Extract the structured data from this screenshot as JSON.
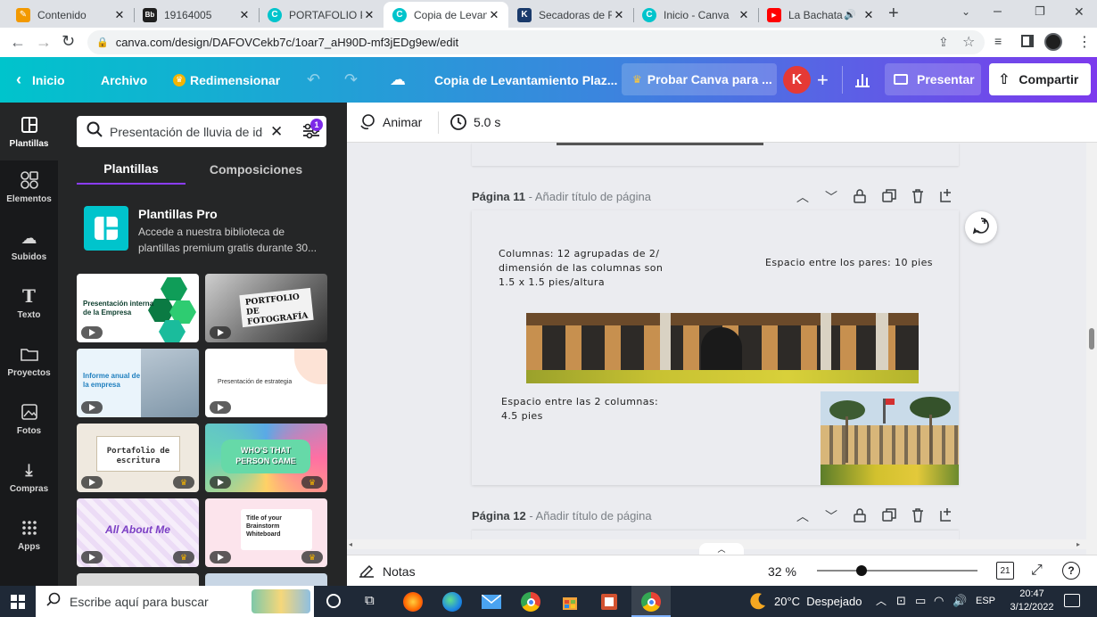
{
  "browser": {
    "tabs": [
      {
        "label": "Contenido",
        "icon": "orange-doc-icon",
        "color": "#f29900"
      },
      {
        "label": "19164005",
        "icon": "bb-icon",
        "color": "#1f1f1f"
      },
      {
        "label": "PORTAFOLIO PRO",
        "icon": "canva-icon",
        "color": "#00c4cc"
      },
      {
        "label": "Copia de Levantamiento",
        "icon": "canva-icon",
        "color": "#00c4cc"
      },
      {
        "label": "Secadoras de Ro",
        "icon": "generic-icon",
        "color": "#1a3a6b"
      },
      {
        "label": "Inicio - Canva",
        "icon": "canva-icon",
        "color": "#00c4cc"
      },
      {
        "label": "La Bachata",
        "icon": "youtube-icon",
        "color": "#ff0000"
      }
    ],
    "url": "canva.com/design/DAFOVCekb7c/1oar7_aH90D-mf3jEDg9ew/edit"
  },
  "header": {
    "home": "Inicio",
    "file": "Archivo",
    "resize": "Redimensionar",
    "title": "Copia de Levantamiento Plaz...",
    "try_pro": "Probar Canva para ...",
    "avatar": "K",
    "present": "Presentar",
    "share": "Compartir"
  },
  "rail": {
    "items": [
      "Plantillas",
      "Elementos",
      "Subidos",
      "Texto",
      "Proyectos",
      "Fotos",
      "Compras",
      "Apps"
    ]
  },
  "panel": {
    "search_value": "Presentación de lluvia de ide",
    "filter_badge": "1",
    "tab_templates": "Plantillas",
    "tab_compositions": "Composiciones",
    "pro_title": "Plantillas Pro",
    "pro_desc": "Accede a nuestra biblioteca de plantillas premium gratis durante 30...",
    "thumbs": {
      "t1": "Presentación interna de la Empresa",
      "t2": "PORTFOLIO DE FOTOGRAFÍA",
      "t3": "Informe anual de la empresa",
      "t4": "Presentación de estrategia",
      "t5": "Portafolio de escritura",
      "t6": "WHO'S THAT PERSON GAME",
      "t7": "All About Me",
      "t8": "Title of your Brainstorm Whiteboard"
    }
  },
  "editor": {
    "animate": "Animar",
    "duration": "5.0 s",
    "page11_label": "Página 11",
    "page11_sub": "- Añadir título de página",
    "page12_label": "Página 12",
    "page12_sub": "- Añadir título de página",
    "text_columns": "Columnas: 12 agrupadas de 2/ dimensión de las columnas son 1.5 x 1.5 pies/altura",
    "text_pairs": "Espacio entre los pares: 10 pies",
    "text_between": "Espacio entre las 2 columnas: 4.5 pies",
    "notes": "Notas",
    "zoom": "32 %",
    "zoom_fraction": 0.32,
    "page_count": "21"
  },
  "taskbar": {
    "search_placeholder": "Escribe aquí para buscar",
    "weather": "20°C  Despejado",
    "lang": "ESP",
    "time": "20:47",
    "date": "3/12/2022"
  }
}
